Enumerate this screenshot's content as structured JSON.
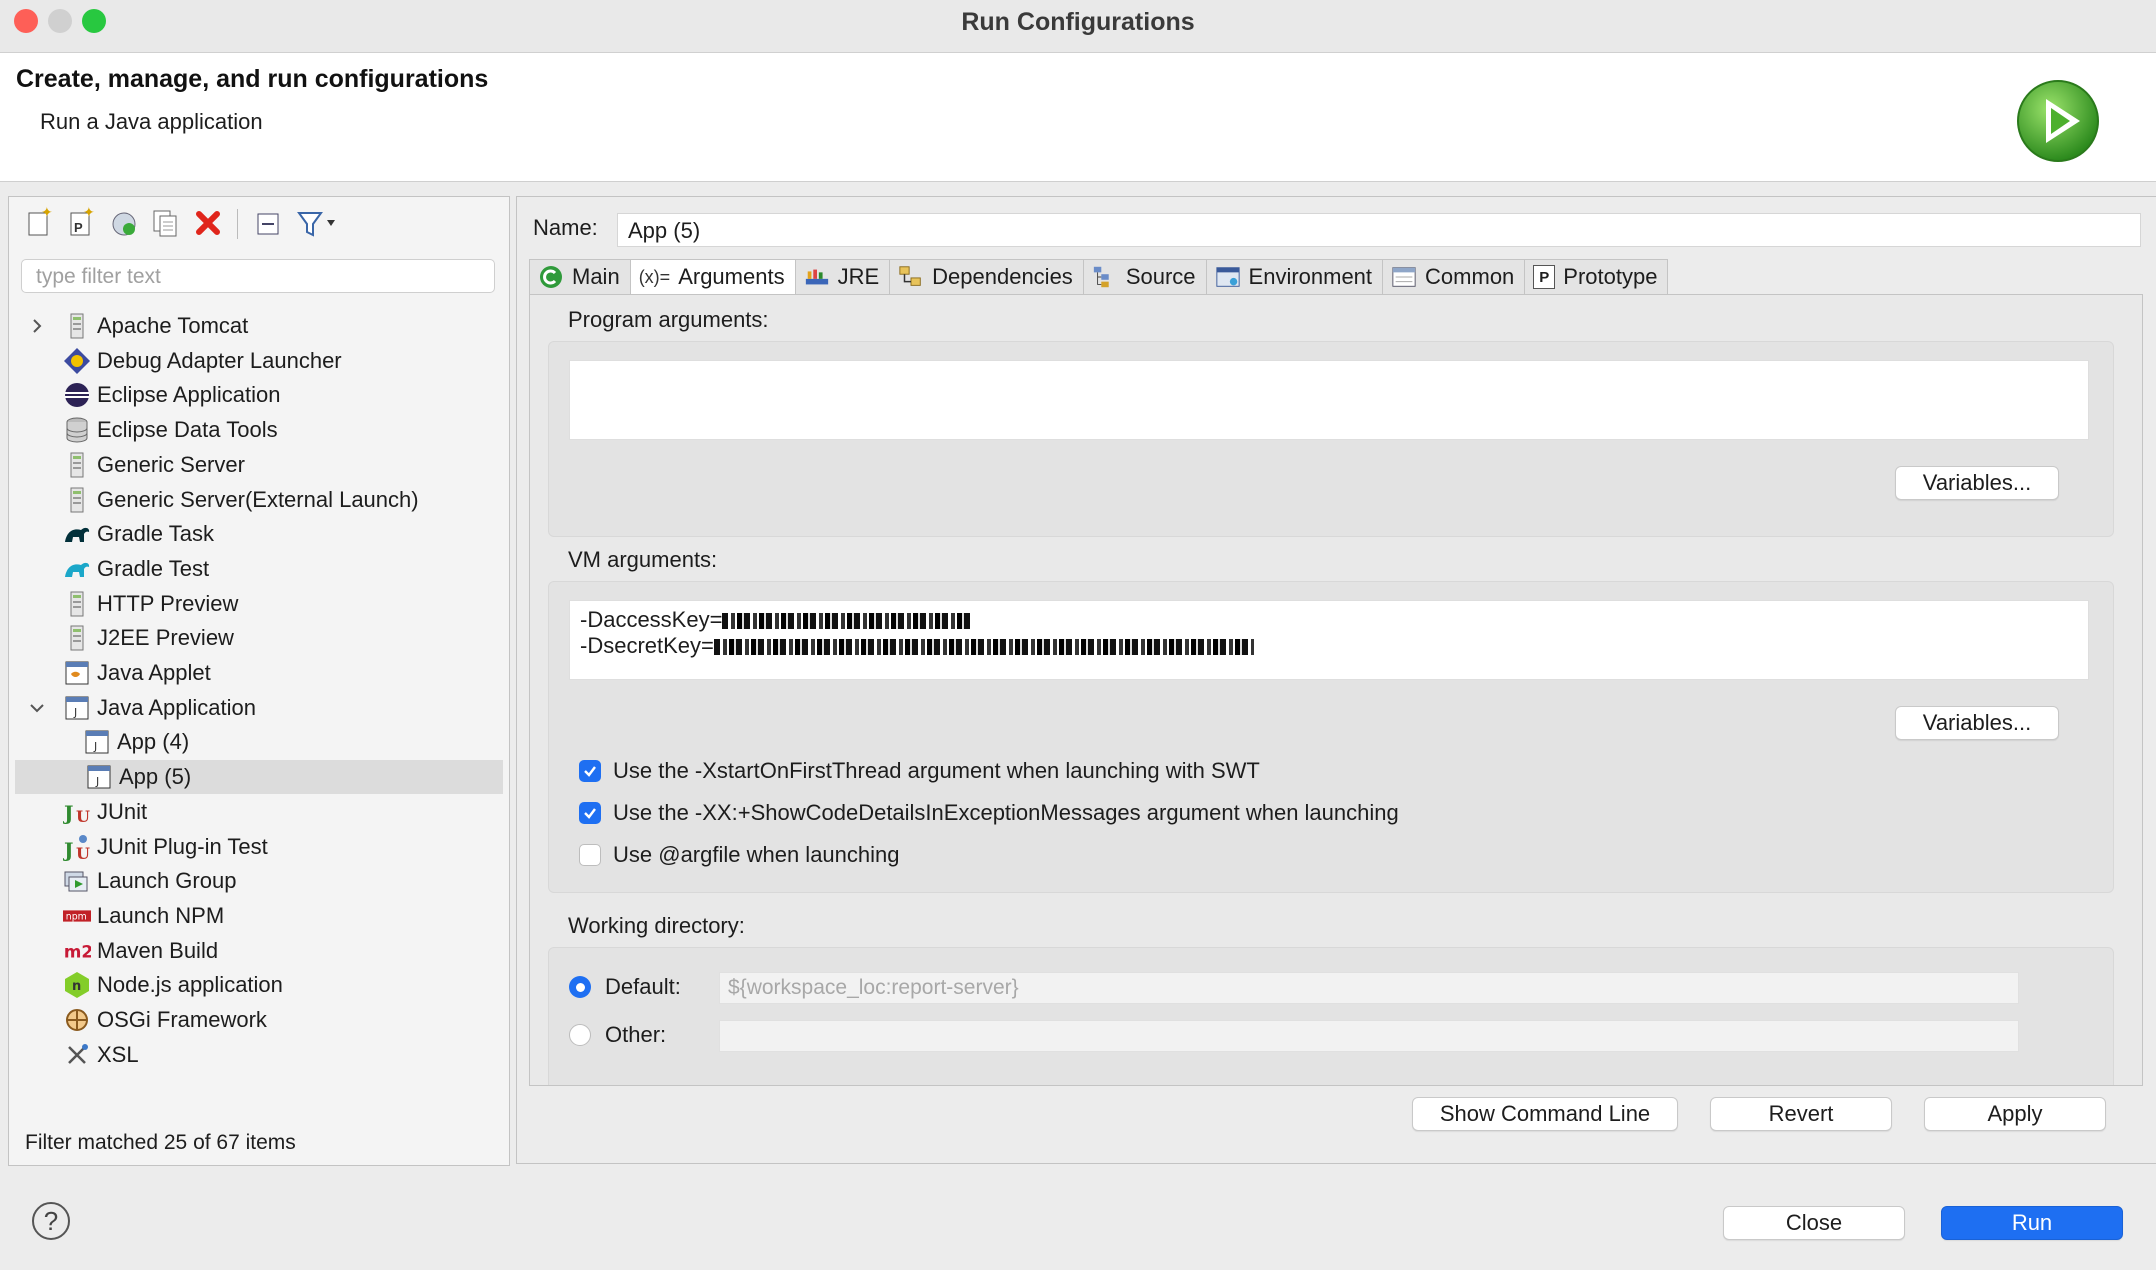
{
  "window": {
    "title": "Run Configurations",
    "traffic_lights": {
      "close": "#fe5f57",
      "minimize": "#d0d0d0",
      "maximize": "#28c840"
    }
  },
  "header": {
    "title": "Create, manage, and run configurations",
    "subtitle": "Run a Java application"
  },
  "left": {
    "toolbar_icons": [
      "new-config-icon",
      "new-prototype-icon",
      "export-icon",
      "duplicate-icon",
      "delete-icon",
      "collapse-all-icon",
      "filter-icon"
    ],
    "filter_placeholder": "type filter text",
    "tree": [
      {
        "label": "Apache Tomcat",
        "icon": "server-icon",
        "level": 0,
        "expander": "collapsed"
      },
      {
        "label": "Debug Adapter Launcher",
        "icon": "debug-adapter-icon",
        "level": 0
      },
      {
        "label": "Eclipse Application",
        "icon": "eclipse-icon",
        "level": 0
      },
      {
        "label": "Eclipse Data Tools",
        "icon": "database-icon",
        "level": 0
      },
      {
        "label": "Generic Server",
        "icon": "server-icon",
        "level": 0
      },
      {
        "label": "Generic Server(External Launch)",
        "icon": "server-icon",
        "level": 0
      },
      {
        "label": "Gradle Task",
        "icon": "gradle-icon",
        "level": 0
      },
      {
        "label": "Gradle Test",
        "icon": "gradle-test-icon",
        "level": 0
      },
      {
        "label": "HTTP Preview",
        "icon": "server-icon",
        "level": 0
      },
      {
        "label": "J2EE Preview",
        "icon": "server-icon",
        "level": 0
      },
      {
        "label": "Java Applet",
        "icon": "java-applet-icon",
        "level": 0
      },
      {
        "label": "Java Application",
        "icon": "java-app-icon",
        "level": 0,
        "expander": "expanded"
      },
      {
        "label": "App (4)",
        "icon": "java-app-icon",
        "level": 1
      },
      {
        "label": "App (5)",
        "icon": "java-app-icon",
        "level": 1,
        "selected": true
      },
      {
        "label": "JUnit",
        "icon": "junit-icon",
        "level": 0
      },
      {
        "label": "JUnit Plug-in Test",
        "icon": "junit-plugin-icon",
        "level": 0
      },
      {
        "label": "Launch Group",
        "icon": "launch-group-icon",
        "level": 0
      },
      {
        "label": "Launch NPM",
        "icon": "npm-icon",
        "level": 0
      },
      {
        "label": "Maven Build",
        "icon": "maven-icon",
        "level": 0
      },
      {
        "label": "Node.js application",
        "icon": "nodejs-icon",
        "level": 0
      },
      {
        "label": "OSGi Framework",
        "icon": "osgi-icon",
        "level": 0
      },
      {
        "label": "XSL",
        "icon": "xsl-icon",
        "level": 0
      }
    ],
    "status": "Filter matched 25 of 67 items"
  },
  "right": {
    "name_label": "Name:",
    "name_value": "App (5)",
    "tabs": [
      {
        "label": "Main",
        "icon": "main-tab-icon"
      },
      {
        "label": "Arguments",
        "icon": "arguments-icon",
        "active": true,
        "icon_text": "(x)="
      },
      {
        "label": "JRE",
        "icon": "jre-icon"
      },
      {
        "label": "Dependencies",
        "icon": "dependencies-icon"
      },
      {
        "label": "Source",
        "icon": "source-icon"
      },
      {
        "label": "Environment",
        "icon": "environment-icon"
      },
      {
        "label": "Common",
        "icon": "common-icon"
      },
      {
        "label": "Prototype",
        "icon": "prototype-icon",
        "icon_text": "P"
      }
    ],
    "program_args_label": "Program arguments:",
    "program_args_value": "",
    "variables_label": "Variables...",
    "vm_args_label": "VM arguments:",
    "vm_args_lines": [
      "-DaccessKey=",
      "-DsecretKey="
    ],
    "checkboxes": [
      {
        "label": "Use the -XstartOnFirstThread argument when launching with SWT",
        "checked": true
      },
      {
        "label": "Use the -XX:+ShowCodeDetailsInExceptionMessages argument when launching",
        "checked": true
      },
      {
        "label": "Use @argfile when launching",
        "checked": false
      }
    ],
    "working_dir_label": "Working directory:",
    "default_label": "Default:",
    "default_value": "${workspace_loc:report-server}",
    "other_label": "Other:",
    "buttons": {
      "show_command_line": "Show Command Line",
      "revert": "Revert",
      "apply": "Apply"
    }
  },
  "footer": {
    "close": "Close",
    "run": "Run",
    "help_glyph": "?"
  },
  "colors": {
    "accent": "#1e6ff2",
    "selection": "#dcdcdc"
  }
}
